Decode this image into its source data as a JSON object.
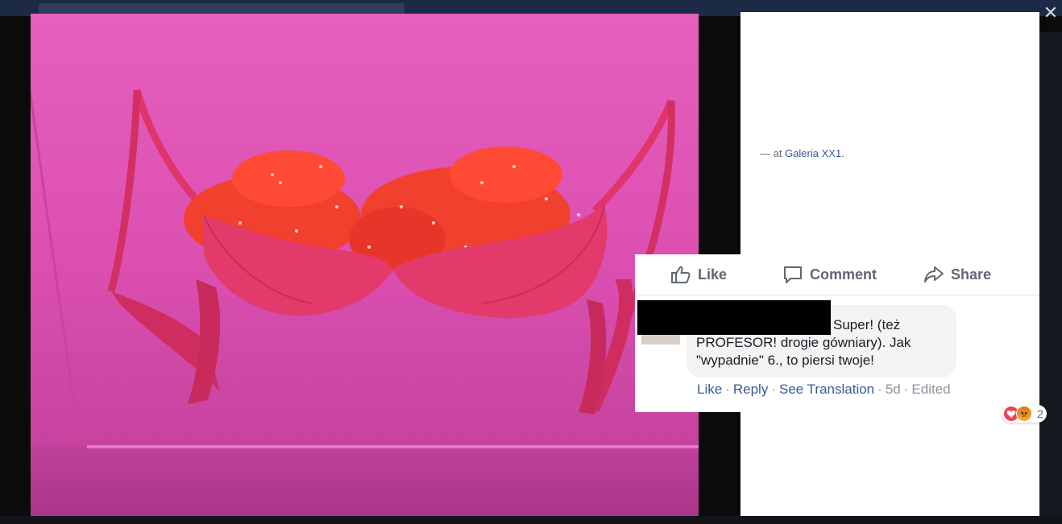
{
  "viewer": {
    "close_icon": "close-icon",
    "close_glyph": "✕"
  },
  "photo": {
    "subject": "red bra filled with red dice on pink wall",
    "colors": {
      "wall": "#e75fbe",
      "fabric": "#e23a6b",
      "dice": "#ff3b2f"
    }
  },
  "post": {
    "location_prefix": "— at ",
    "location_name": "Galeria XX1",
    "location_suffix": "."
  },
  "actions": {
    "like_label": "Like",
    "comment_label": "Comment",
    "share_label": "Share"
  },
  "comment": {
    "text_line1": "Super! (też",
    "text_rest": "PROFESOR! drogie gówniary). Jak \"wypadnie\" 6., to piersi twoje!",
    "reactions_icons": [
      "love-icon",
      "angry-icon"
    ],
    "reactions_count": "2",
    "like_label": "Like",
    "reply_label": "Reply",
    "translation_label": "See Translation",
    "time": "5d",
    "edited_label": "Edited",
    "separator": "·"
  }
}
